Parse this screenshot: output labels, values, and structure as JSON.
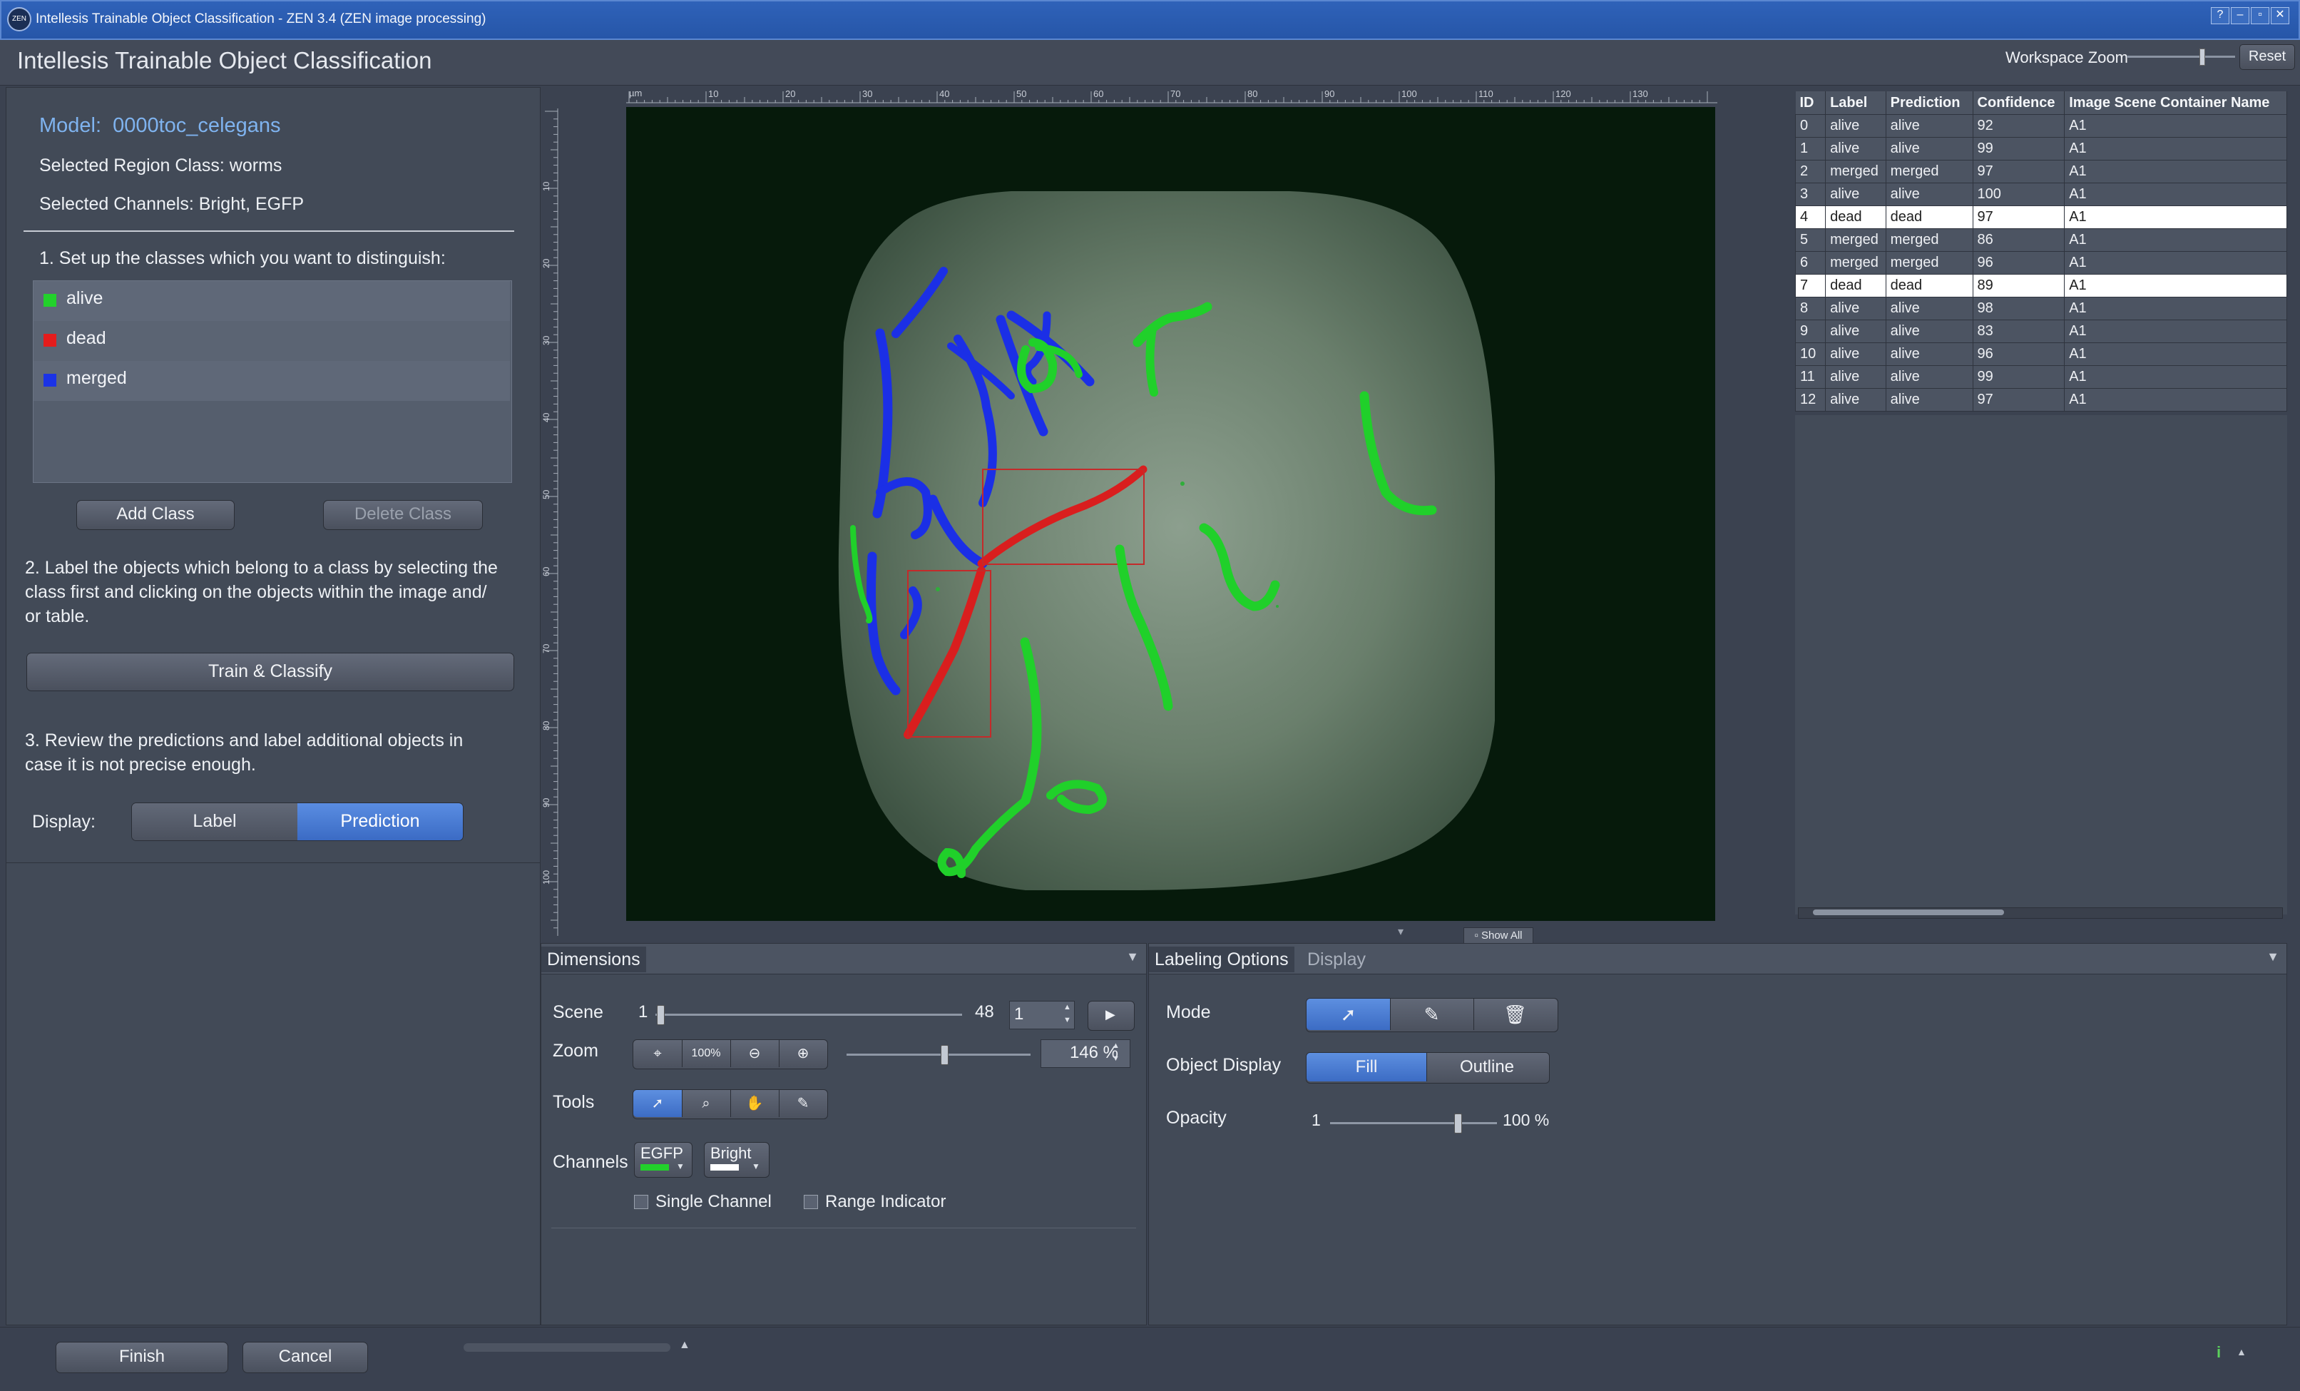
{
  "window": {
    "title": "Intellesis Trainable Object Classification - ZEN 3.4 (ZEN image processing)",
    "logo": "ZEN",
    "controls": [
      "?",
      "–",
      "▫",
      "✕"
    ]
  },
  "header": {
    "title": "Intellesis Trainable Object Classification",
    "workspace_zoom_label": "Workspace Zoom",
    "workspace_zoom_level": 0.7,
    "reset_label": "Reset"
  },
  "left_panel": {
    "model_label": "Model:",
    "model_name": "0000toc_celegans",
    "region_class": "Selected Region Class: worms",
    "channels": "Selected Channels: Bright, EGFP",
    "step1": "1. Set up the classes which you want to distinguish:",
    "classes": [
      {
        "name": "alive",
        "color": "#22d12b"
      },
      {
        "name": "dead",
        "color": "#e41c1c"
      },
      {
        "name": "merged",
        "color": "#1b33e6"
      }
    ],
    "add_class": "Add Class",
    "delete_class": "Delete Class",
    "step2_line1": "2. Label the objects which belong to a class by selecting the",
    "step2_line2": "class first and clicking on the objects within the image and/",
    "step2_line3": "or table.",
    "train_classify": "Train & Classify",
    "step3_line1": "3. Review the predictions and label additional objects in",
    "step3_line2": "case it is not precise enough.",
    "display_label": "Display:",
    "display_options": [
      "Label",
      "Prediction"
    ],
    "display_selected": "Prediction"
  },
  "viewer": {
    "ruler_unit": "µm",
    "x_ticks": [
      "10",
      "20",
      "30",
      "40",
      "50",
      "60",
      "70",
      "80",
      "90",
      "100",
      "110",
      "120",
      "130"
    ],
    "y_ticks": [
      "10",
      "20",
      "30",
      "40",
      "50",
      "60",
      "70",
      "80",
      "90",
      "100"
    ],
    "show_all": "Show All"
  },
  "table": {
    "columns": [
      "ID",
      "Label",
      "Prediction",
      "Confidence",
      "Image Scene Container Name"
    ],
    "rows": [
      {
        "id": "0",
        "label": "alive",
        "prediction": "alive",
        "confidence": "92",
        "container": "A1",
        "selected": false
      },
      {
        "id": "1",
        "label": "alive",
        "prediction": "alive",
        "confidence": "99",
        "container": "A1",
        "selected": false
      },
      {
        "id": "2",
        "label": "merged",
        "prediction": "merged",
        "confidence": "97",
        "container": "A1",
        "selected": false
      },
      {
        "id": "3",
        "label": "alive",
        "prediction": "alive",
        "confidence": "100",
        "container": "A1",
        "selected": false
      },
      {
        "id": "4",
        "label": "dead",
        "prediction": "dead",
        "confidence": "97",
        "container": "A1",
        "selected": true
      },
      {
        "id": "5",
        "label": "merged",
        "prediction": "merged",
        "confidence": "86",
        "container": "A1",
        "selected": false
      },
      {
        "id": "6",
        "label": "merged",
        "prediction": "merged",
        "confidence": "96",
        "container": "A1",
        "selected": false
      },
      {
        "id": "7",
        "label": "dead",
        "prediction": "dead",
        "confidence": "89",
        "container": "A1",
        "selected": true
      },
      {
        "id": "8",
        "label": "alive",
        "prediction": "alive",
        "confidence": "98",
        "container": "A1",
        "selected": false
      },
      {
        "id": "9",
        "label": "alive",
        "prediction": "alive",
        "confidence": "83",
        "container": "A1",
        "selected": false
      },
      {
        "id": "10",
        "label": "alive",
        "prediction": "alive",
        "confidence": "96",
        "container": "A1",
        "selected": false
      },
      {
        "id": "11",
        "label": "alive",
        "prediction": "alive",
        "confidence": "99",
        "container": "A1",
        "selected": false
      },
      {
        "id": "12",
        "label": "alive",
        "prediction": "alive",
        "confidence": "97",
        "container": "A1",
        "selected": false
      }
    ]
  },
  "dimensions": {
    "tab": "Dimensions",
    "scene_label": "Scene",
    "scene_min": "1",
    "scene_max": "48",
    "scene_value": "1",
    "zoom_label": "Zoom",
    "zoom_100": "100%",
    "zoom_value": "146 %",
    "tools_label": "Tools",
    "channels_label": "Channels",
    "channel_1": "EGFP",
    "channel_2": "Bright",
    "single_channel": "Single Channel",
    "range_indicator": "Range Indicator"
  },
  "labeling": {
    "tab_active": "Labeling Options",
    "tab_other": "Display",
    "mode_label": "Mode",
    "object_display_label": "Object Display",
    "fill": "Fill",
    "outline": "Outline",
    "opacity_label": "Opacity",
    "opacity_min": "1",
    "opacity_value": "100 %"
  },
  "footer": {
    "finish": "Finish",
    "cancel": "Cancel",
    "info": "i"
  },
  "colors": {
    "accent": "#3f72cc",
    "alive": "#22d12b",
    "dead": "#e41c1c",
    "merged": "#1b33e6"
  }
}
